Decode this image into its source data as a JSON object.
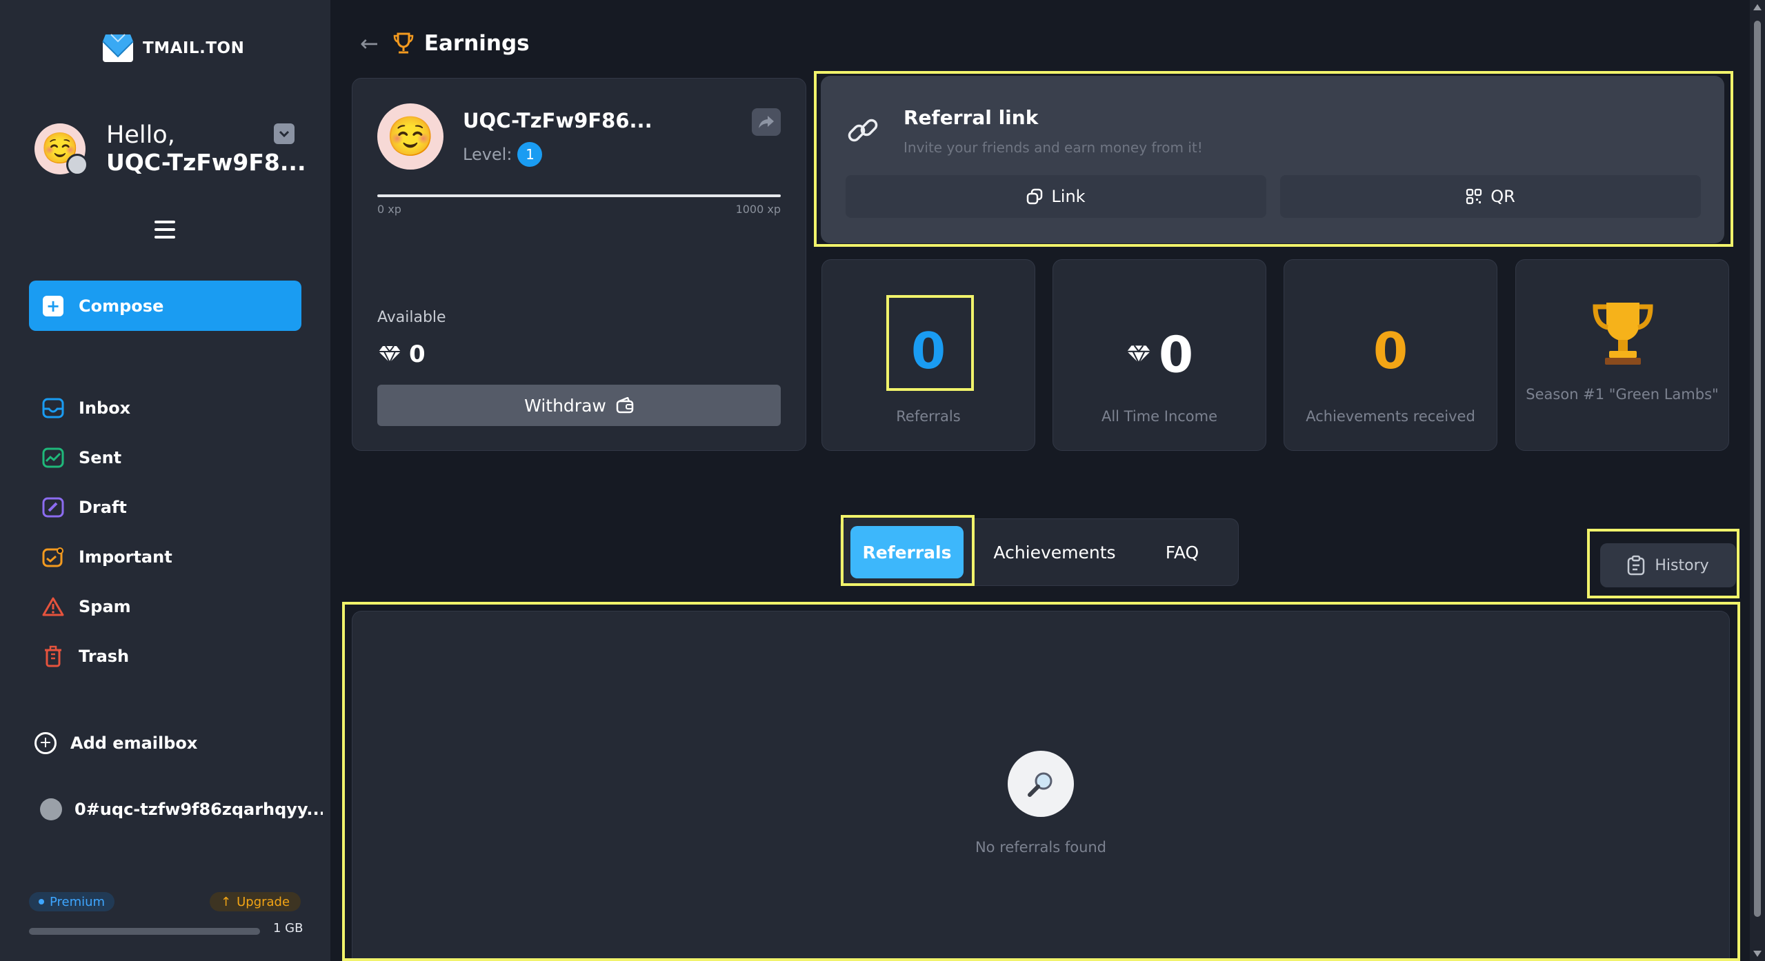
{
  "app": {
    "logo_text": "TMAIL.TON"
  },
  "user": {
    "greeting": "Hello,",
    "name": "UQC-TzFw9F8..."
  },
  "compose_label": "Compose",
  "nav": [
    {
      "label": "Inbox",
      "icon": "inbox-icon"
    },
    {
      "label": "Sent",
      "icon": "sent-icon"
    },
    {
      "label": "Draft",
      "icon": "draft-icon"
    },
    {
      "label": "Important",
      "icon": "important-icon"
    },
    {
      "label": "Spam",
      "icon": "spam-icon"
    },
    {
      "label": "Trash",
      "icon": "trash-icon"
    }
  ],
  "add_emailbox_label": "Add emailbox",
  "account_label": "0#uqc-tzfw9f86zqarhqyy...",
  "plan": {
    "premium": "Premium",
    "upgrade": "Upgrade",
    "storage": "1 GB",
    "storage_used_fraction": 0
  },
  "page": {
    "title": "Earnings"
  },
  "profile": {
    "name": "UQC-TzFw9F86...",
    "level_label": "Level:",
    "level": "1",
    "xp_min": "0 xp",
    "xp_max": "1000 xp",
    "xp_progress_fraction": 0,
    "available_label": "Available",
    "balance": "0",
    "withdraw_label": "Withdraw"
  },
  "referral": {
    "title": "Referral link",
    "subtitle": "Invite your friends and earn money from it!",
    "link_label": "Link",
    "qr_label": "QR"
  },
  "stats": [
    {
      "value": "0",
      "label": "Referrals",
      "color": "#1a9cf2"
    },
    {
      "value": "0",
      "label": "All Time Income",
      "color": "#ffffff"
    },
    {
      "value": "0",
      "label": "Achievements received",
      "color": "#f3a515"
    },
    {
      "label": "Season #1 \"Green Lambs\""
    }
  ],
  "tabs": [
    {
      "label": "Referrals",
      "active": true
    },
    {
      "label": "Achievements",
      "active": false
    },
    {
      "label": "FAQ",
      "active": false
    }
  ],
  "history_label": "History",
  "empty_state": "No referrals found",
  "colors": {
    "accent": "#1a9cf2",
    "highlight": "#f1f36b",
    "gold": "#f3a515",
    "background": "#161a23",
    "sidebar": "#252a35"
  }
}
